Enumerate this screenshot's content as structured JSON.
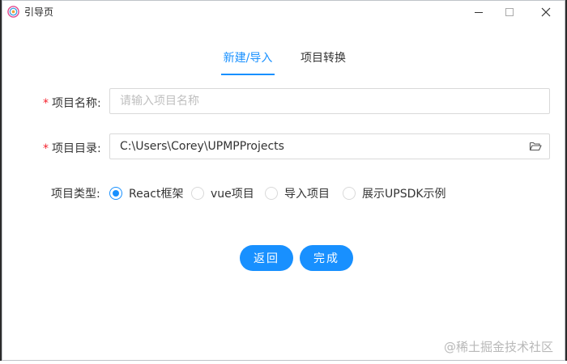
{
  "window": {
    "title": "引导页",
    "controls": [
      "minimize-icon",
      "maximize-icon",
      "close-icon"
    ]
  },
  "tabs": [
    {
      "label": "新建/导入",
      "active": true
    },
    {
      "label": "项目转换",
      "active": false
    }
  ],
  "form": {
    "required_mark": "*",
    "project_name": {
      "label": "项目名称:",
      "placeholder": "请输入项目名称",
      "value": ""
    },
    "project_dir": {
      "label": "项目目录:",
      "value": "C:\\Users\\Corey\\UPMPProjects",
      "icon": "folder-open-icon"
    },
    "project_type": {
      "label": "项目类型:",
      "options": [
        {
          "label": "React框架",
          "checked": true
        },
        {
          "label": "vue项目",
          "checked": false
        },
        {
          "label": "导入项目",
          "checked": false
        },
        {
          "label": "展示UPSDK示例",
          "checked": false
        }
      ]
    }
  },
  "actions": {
    "back_label": "返回",
    "done_label": "完成"
  },
  "watermark": "@稀土掘金技术社区",
  "colors": {
    "accent": "#1890ff",
    "required": "#f5222d",
    "placeholder": "#bfbfbf",
    "border": "#d9d9d9"
  }
}
